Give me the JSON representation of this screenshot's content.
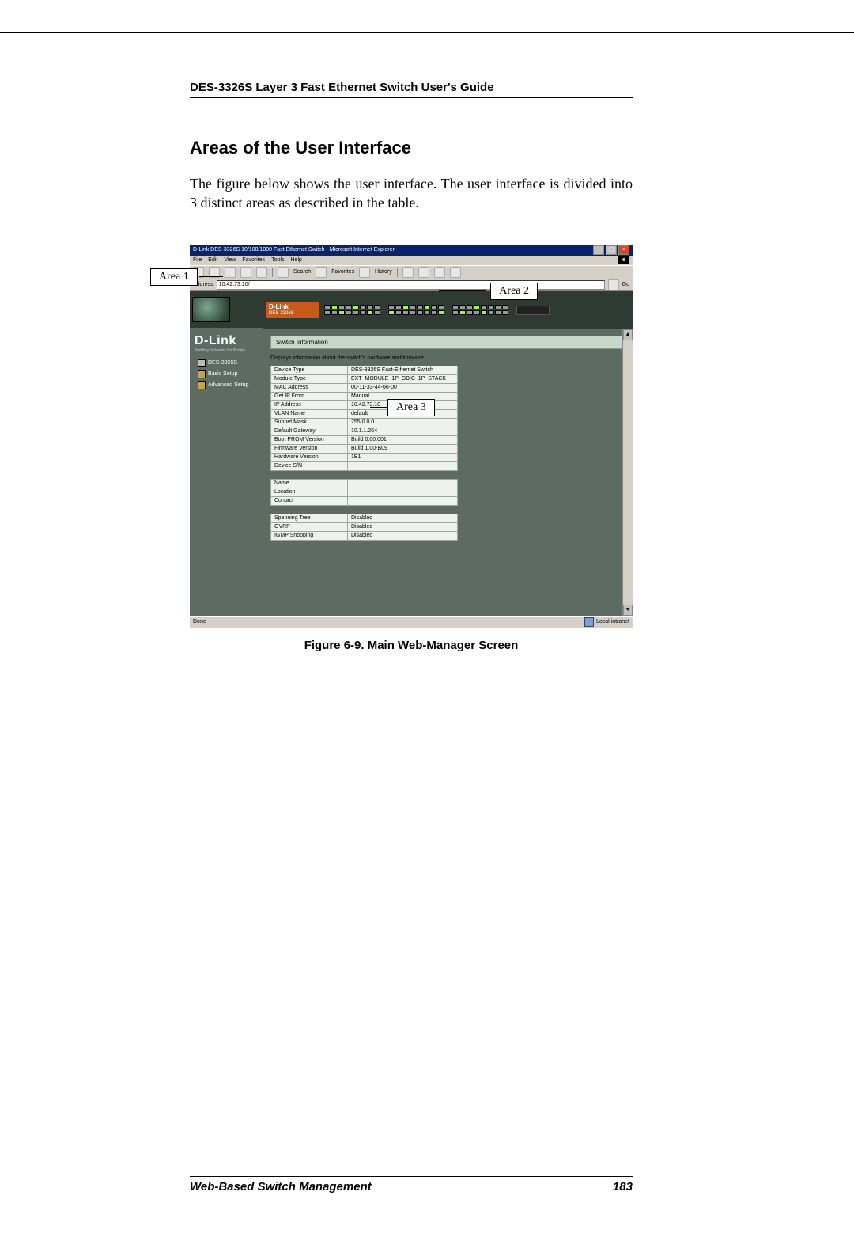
{
  "doc": {
    "header": "DES-3326S Layer 3 Fast Ethernet Switch User's Guide",
    "section": "Areas of the User Interface",
    "paragraph": "The figure below shows the user interface.  The user interface is divided into 3 distinct areas as described in the table.",
    "caption": "Figure 6-9.  Main Web-Manager Screen",
    "footer_left": "Web-Based Switch Management",
    "footer_right": "183"
  },
  "callouts": {
    "a1": "Area 1",
    "a2": "Area 2",
    "a3": "Area 3"
  },
  "browser": {
    "title": "D-Link DES-3326S 10/100/1000 Fast Ethernet Switch - Microsoft Internet Explorer",
    "menu": [
      "File",
      "Edit",
      "View",
      "Favorites",
      "Tools",
      "Help"
    ],
    "toolbar_labels": {
      "search": "Search",
      "favorites": "Favorites",
      "history": "History"
    },
    "address_label": "Address",
    "address_value": "10.42.73.10/",
    "go": "Go",
    "status_left": "Done",
    "status_right": "Local intranet"
  },
  "sidebar": {
    "brand": "D-Link",
    "tagline": "Building Networks for People",
    "model": "DES-3326S",
    "basic": "Basic Setup",
    "advanced": "Advanced Setup"
  },
  "device_header": {
    "model": "DES-3326S",
    "brand": "D-Link"
  },
  "panel": {
    "title": "Switch Information",
    "desc": "Displays information about the switch's hardware and firmware.",
    "rows_a": [
      {
        "k": "Device Type",
        "v": "DES-3326S Fast-Ethernet Switch"
      },
      {
        "k": "Module Type",
        "v": "EXT_MODULE_1P_GBIC_1P_STACK"
      },
      {
        "k": "MAC Address",
        "v": "00-11-33-44-66-00"
      },
      {
        "k": "Get IP From",
        "v": "Manual"
      },
      {
        "k": "IP Address",
        "v": "10.42.73.10"
      },
      {
        "k": "VLAN Name",
        "v": "default"
      },
      {
        "k": "Subnet Mask",
        "v": "255.0.0.0"
      },
      {
        "k": "Default Gateway",
        "v": "10.1.1.254"
      },
      {
        "k": "Boot PROM Version",
        "v": "Build 0.00.001"
      },
      {
        "k": "Firmware Version",
        "v": "Build 1.00-B09"
      },
      {
        "k": "Hardware Version",
        "v": "1B1"
      },
      {
        "k": "Device S/N",
        "v": ""
      }
    ],
    "rows_b": [
      {
        "k": "Name",
        "v": ""
      },
      {
        "k": "Location",
        "v": ""
      },
      {
        "k": "Contact",
        "v": ""
      }
    ],
    "rows_c": [
      {
        "k": "Spanning Tree",
        "v": "Disabled"
      },
      {
        "k": "GVRP",
        "v": "Disabled"
      },
      {
        "k": "IGMP Snooping",
        "v": "Disabled"
      }
    ]
  }
}
